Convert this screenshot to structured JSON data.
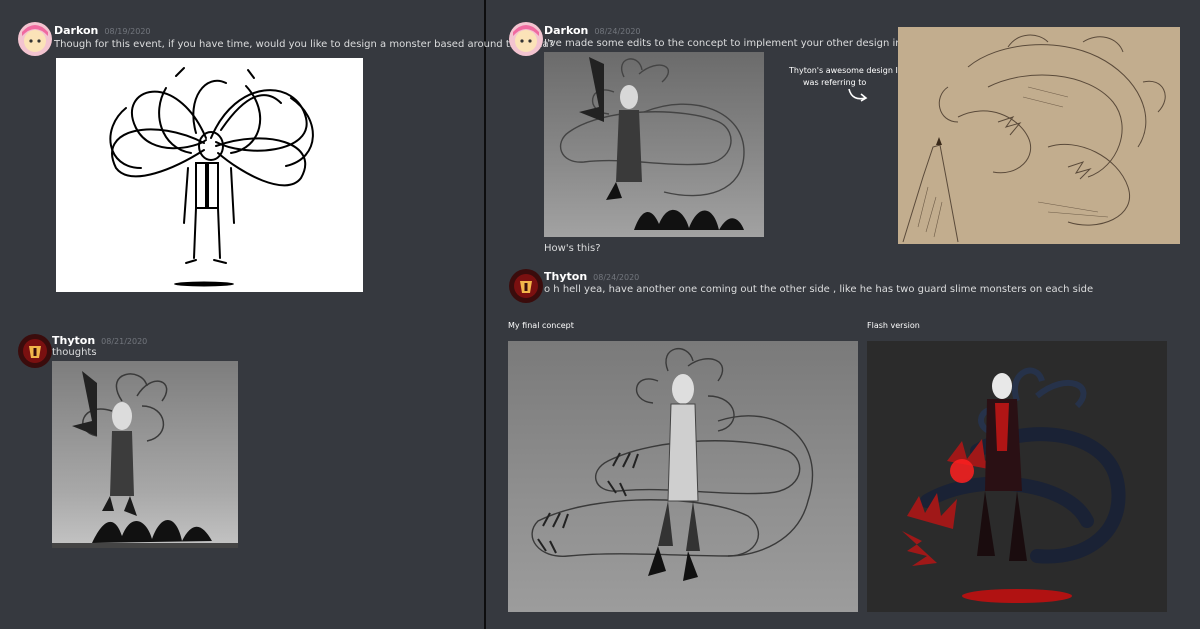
{
  "left": {
    "msg1": {
      "author": "Darkon",
      "timestamp": "08/19/2020",
      "text": "Though for this event, if you have time, would you like to design a monster based around this idea?"
    },
    "msg2": {
      "author": "Thyton",
      "timestamp": "08/21/2020",
      "text": "thoughts"
    }
  },
  "right": {
    "msg1": {
      "author": "Darkon",
      "timestamp": "08/24/2020",
      "text": "I've made some edits to the concept to implement your other design into it too",
      "followup": "How's this?"
    },
    "annotation": {
      "line1": "Thyton's awesome design I",
      "line2": "was referring to"
    },
    "msg2": {
      "author": "Thyton",
      "timestamp": "08/24/2020",
      "text": "o h hell yea, have another one coming out the other side , like he has two guard slime monsters on each side"
    },
    "captions": {
      "final": "My final concept",
      "flash": "Flash version"
    }
  },
  "icons": [
    "darkon-avatar",
    "thyton-avatar",
    "curved-arrow-icon"
  ],
  "colors": {
    "background": "#36393f",
    "divider": "#0d0d0e",
    "timestamp": "#72767d",
    "text": "#dcddde"
  }
}
